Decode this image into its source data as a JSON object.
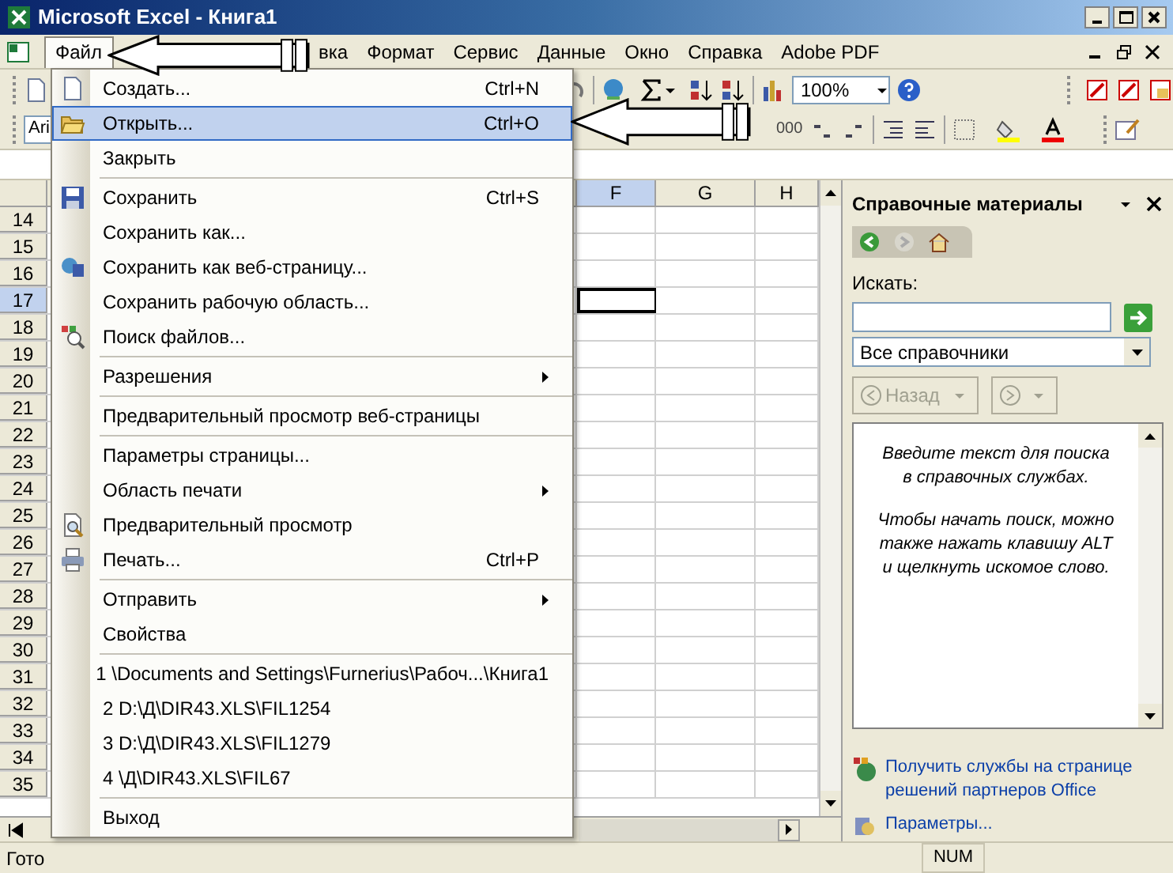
{
  "window": {
    "title": "Microsoft Excel - Книга1"
  },
  "menu_bar": [
    {
      "label": "Файл",
      "selected": true
    },
    {
      "label": "вка",
      "selected": false
    },
    {
      "label": "Формат",
      "selected": false
    },
    {
      "label": "Сервис",
      "selected": false
    },
    {
      "label": "Данные",
      "selected": false
    },
    {
      "label": "Окно",
      "selected": false
    },
    {
      "label": "Справка",
      "selected": false
    },
    {
      "label": "Adobe PDF",
      "selected": false
    }
  ],
  "toolbar": {
    "font": "Ari",
    "number_format": "000",
    "zoom": "100%"
  },
  "sheet": {
    "columns": [
      {
        "label": "F",
        "selected": true
      },
      {
        "label": "G",
        "selected": false
      },
      {
        "label": "H",
        "selected": false
      }
    ],
    "rows": [
      {
        "label": "14",
        "selected": false
      },
      {
        "label": "15",
        "selected": false
      },
      {
        "label": "16",
        "selected": false
      },
      {
        "label": "17",
        "selected": true
      },
      {
        "label": "18",
        "selected": false
      },
      {
        "label": "19",
        "selected": false
      },
      {
        "label": "20",
        "selected": false
      },
      {
        "label": "21",
        "selected": false
      },
      {
        "label": "22",
        "selected": false
      },
      {
        "label": "23",
        "selected": false
      },
      {
        "label": "24",
        "selected": false
      },
      {
        "label": "25",
        "selected": false
      },
      {
        "label": "26",
        "selected": false
      },
      {
        "label": "27",
        "selected": false
      },
      {
        "label": "28",
        "selected": false
      },
      {
        "label": "29",
        "selected": false
      },
      {
        "label": "30",
        "selected": false
      },
      {
        "label": "31",
        "selected": false
      },
      {
        "label": "32",
        "selected": false
      },
      {
        "label": "33",
        "selected": false
      },
      {
        "label": "34",
        "selected": false
      },
      {
        "label": "35",
        "selected": false
      }
    ]
  },
  "file_menu": {
    "items": [
      {
        "label": "Создать...",
        "shortcut": "Ctrl+N",
        "selected": false,
        "submenu": false,
        "divider_before": false
      },
      {
        "label": "Открыть...",
        "shortcut": "Ctrl+O",
        "selected": true,
        "submenu": false,
        "divider_before": false
      },
      {
        "label": "Закрыть",
        "selected": false,
        "submenu": false,
        "divider_before": false
      },
      {
        "label": "Сохранить",
        "shortcut": "Ctrl+S",
        "selected": false,
        "submenu": false,
        "divider_before": true
      },
      {
        "label": "Сохранить как...",
        "selected": false,
        "submenu": false,
        "divider_before": false
      },
      {
        "label": "Сохранить как веб-страницу...",
        "selected": false,
        "submenu": false,
        "divider_before": false
      },
      {
        "label": "Сохранить рабочую область...",
        "selected": false,
        "submenu": false,
        "divider_before": false
      },
      {
        "label": "Поиск файлов...",
        "selected": false,
        "submenu": false,
        "divider_before": false
      },
      {
        "label": "Разрешения",
        "selected": false,
        "submenu": true,
        "divider_before": true
      },
      {
        "label": "Предварительный просмотр веб-страницы",
        "selected": false,
        "submenu": false,
        "divider_before": true
      },
      {
        "label": "Параметры страницы...",
        "selected": false,
        "submenu": false,
        "divider_before": true
      },
      {
        "label": "Область печати",
        "selected": false,
        "submenu": true,
        "divider_before": false
      },
      {
        "label": "Предварительный просмотр",
        "selected": false,
        "submenu": false,
        "divider_before": false
      },
      {
        "label": "Печать...",
        "shortcut": "Ctrl+P",
        "selected": false,
        "submenu": false,
        "divider_before": false
      },
      {
        "label": "Отправить",
        "selected": false,
        "submenu": true,
        "divider_before": true
      },
      {
        "label": "Свойства",
        "selected": false,
        "submenu": false,
        "divider_before": false
      },
      {
        "label": "1 \\Documents and Settings\\Furnerius\\Рабоч...\\Книга1",
        "selected": false,
        "submenu": false,
        "divider_before": true
      },
      {
        "label": "2 D:\\Д\\DIR43.XLS\\FIL1254",
        "selected": false,
        "submenu": false,
        "divider_before": false
      },
      {
        "label": "3 D:\\Д\\DIR43.XLS\\FIL1279",
        "selected": false,
        "submenu": false,
        "divider_before": false
      },
      {
        "label": "4 \\Д\\DIR43.XLS\\FIL67",
        "selected": false,
        "submenu": false,
        "divider_before": false
      },
      {
        "label": "Выход",
        "selected": false,
        "submenu": false,
        "divider_before": true
      }
    ]
  },
  "task_pane": {
    "title": "Справочные материалы",
    "search_label": "Искать:",
    "source": "Все справочники",
    "back": {
      "label": "Назад",
      "disabled": true
    },
    "forward": {
      "disabled": true
    },
    "hint": [
      "Введите текст для поиска в справочных службах.",
      "Чтобы начать поиск, можно также нажать клавишу ALT и щелкнуть искомое слово."
    ],
    "links": [
      "Получить службы на странице решений партнеров Office",
      "Параметры..."
    ]
  },
  "status_bar": {
    "status": "Гото",
    "indicators": [
      "NUM"
    ]
  }
}
